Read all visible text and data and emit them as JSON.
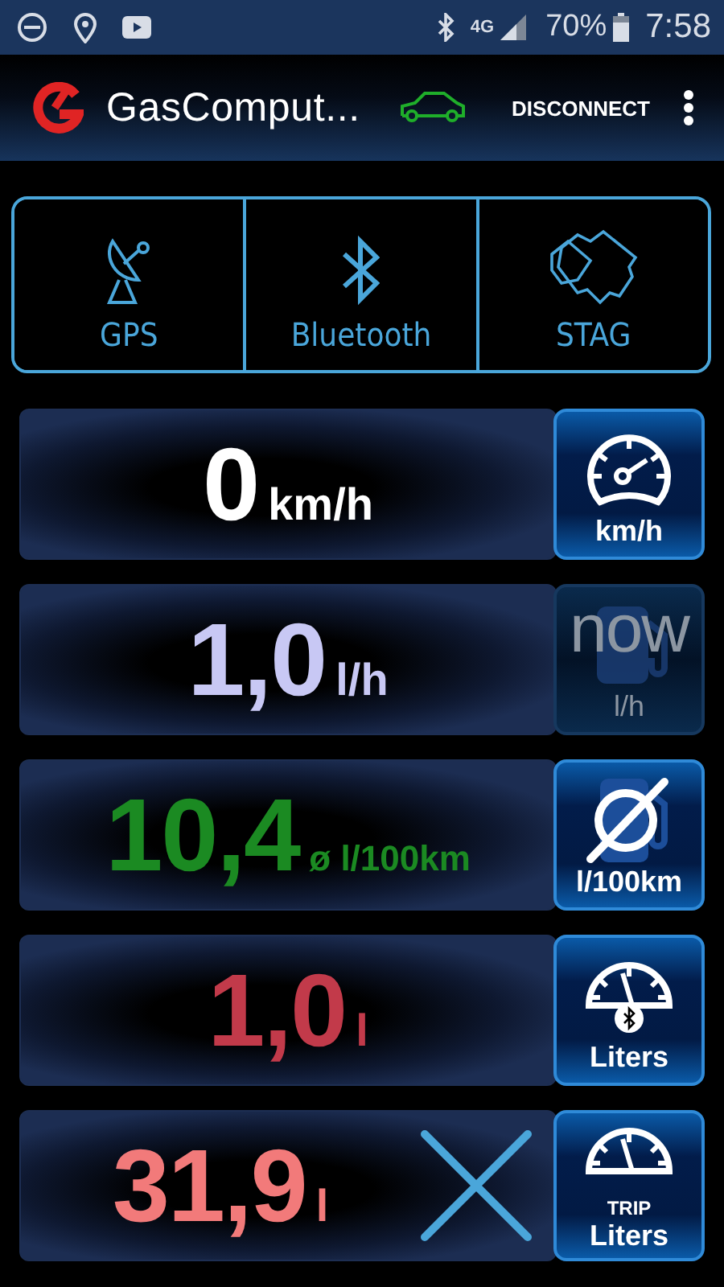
{
  "status_bar": {
    "network": "4G",
    "battery": "70%",
    "time": "7:58"
  },
  "app_bar": {
    "title": "GasComput...",
    "connected": true,
    "action": "DISCONNECT"
  },
  "tiles": [
    {
      "kind": "gps",
      "label": "GPS"
    },
    {
      "kind": "bluetooth",
      "label": "Bluetooth"
    },
    {
      "kind": "stag",
      "label": "STAG"
    }
  ],
  "rows": [
    {
      "value": "0",
      "unit": "km/h",
      "kind": "speed",
      "reset": false,
      "button": {
        "kind": "speedometer",
        "label": "km/h",
        "disabled": false
      }
    },
    {
      "value": "1,0",
      "unit": "l/h",
      "kind": "current",
      "reset": false,
      "button": {
        "kind": "fuel-pump",
        "note": "now",
        "label": "l/h",
        "disabled": true
      }
    },
    {
      "value": "10,4",
      "unit": "ø l/100km",
      "kind": "average",
      "reset": false,
      "button": {
        "kind": "average",
        "label": "l/100km",
        "disabled": false
      }
    },
    {
      "value": "1,0",
      "unit": "l",
      "kind": "total",
      "reset": false,
      "button": {
        "kind": "bt-gauge",
        "label": "Liters",
        "disabled": false
      }
    },
    {
      "value": "31,9",
      "unit": "l",
      "kind": "trip",
      "reset": true,
      "button": {
        "kind": "gauge",
        "caption": "TRIP",
        "label": "Liters",
        "disabled": false
      }
    }
  ]
}
